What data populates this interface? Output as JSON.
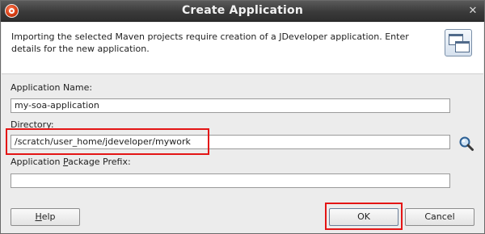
{
  "dialog": {
    "title": "Create Application",
    "description": "Importing the selected Maven projects require creation of a JDeveloper application. Enter details for the new application."
  },
  "form": {
    "app_name_label": "Application Name:",
    "app_name_value": "my-soa-application",
    "directory_label": "Directory:",
    "directory_value": "/scratch/user_home/jdeveloper/mywork",
    "package_prefix_label_pre": "Application ",
    "package_prefix_label_mnemonic": "P",
    "package_prefix_label_post": "ackage Prefix:",
    "package_prefix_value": ""
  },
  "buttons": {
    "help_mnemonic": "H",
    "help_rest": "elp",
    "ok": "OK",
    "cancel": "Cancel"
  },
  "icons": {
    "app": "jdeveloper-icon",
    "close": "close-icon",
    "window": "windows-icon",
    "browse": "search-icon"
  },
  "colors": {
    "highlight": "#e41515",
    "titlebar": "#3a3a3a"
  }
}
